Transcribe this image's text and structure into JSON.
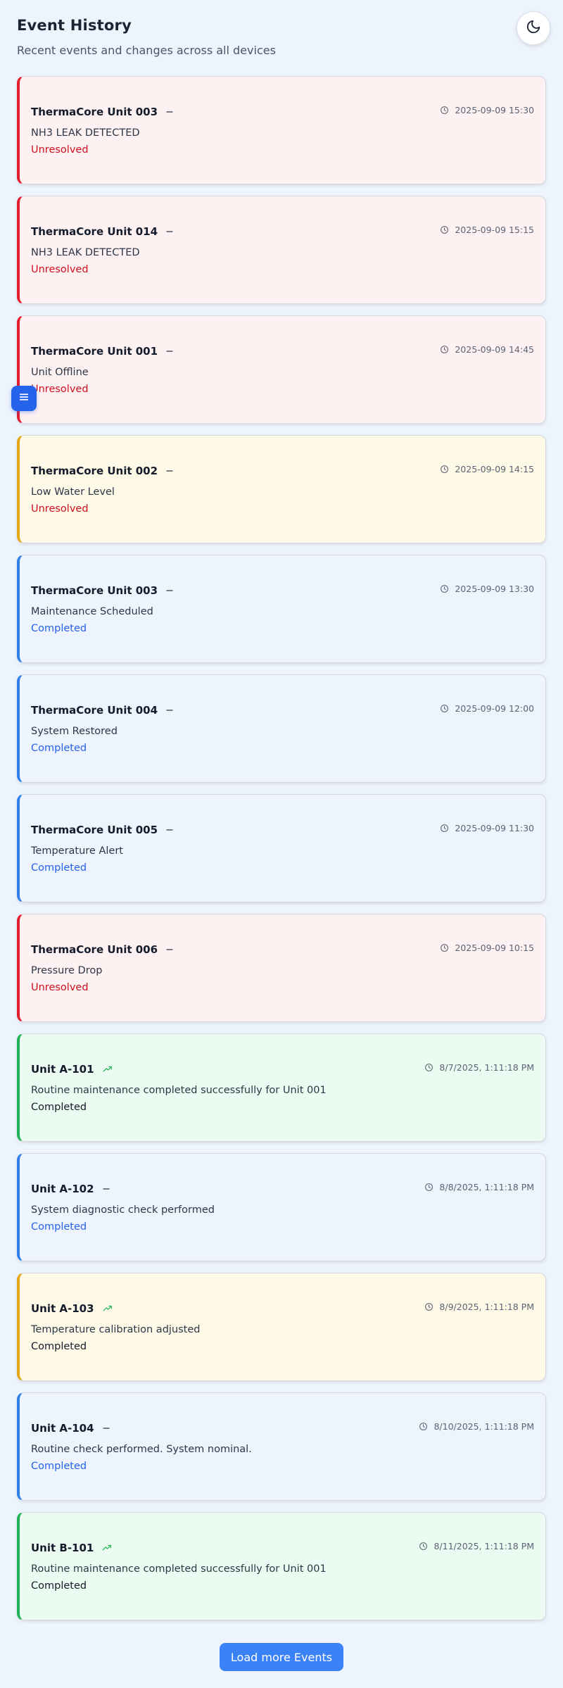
{
  "header": {
    "title": "Event History",
    "subtitle": "Recent events and changes across all devices"
  },
  "theme_toggle": {
    "icon": "moon-icon"
  },
  "menu_button": {
    "icon": "menu-icon"
  },
  "colors": {
    "critical": "#e11d2f",
    "warning": "#e5a81a",
    "info": "#2f7fe8",
    "success": "#20b256",
    "accent": "#3b82f6"
  },
  "events": [
    {
      "unit": "ThermaCore Unit 003",
      "trend": "minus-icon",
      "timestamp": "2025-09-09 15:30",
      "description": "NH3 LEAK DETECTED",
      "status": "Unresolved",
      "severity": "red",
      "status_color": "red"
    },
    {
      "unit": "ThermaCore Unit 014",
      "trend": "minus-icon",
      "timestamp": "2025-09-09 15:15",
      "description": "NH3 LEAK DETECTED",
      "status": "Unresolved",
      "severity": "red",
      "status_color": "red"
    },
    {
      "unit": "ThermaCore Unit 001",
      "trend": "minus-icon",
      "timestamp": "2025-09-09 14:45",
      "description": "Unit Offline",
      "status": "Unresolved",
      "severity": "red",
      "status_color": "red"
    },
    {
      "unit": "ThermaCore Unit 002",
      "trend": "minus-icon",
      "timestamp": "2025-09-09 14:15",
      "description": "Low Water Level",
      "status": "Unresolved",
      "severity": "yellow",
      "status_color": "red"
    },
    {
      "unit": "ThermaCore Unit 003",
      "trend": "minus-icon",
      "timestamp": "2025-09-09 13:30",
      "description": "Maintenance Scheduled",
      "status": "Completed",
      "severity": "blue",
      "status_color": "blue"
    },
    {
      "unit": "ThermaCore Unit 004",
      "trend": "minus-icon",
      "timestamp": "2025-09-09 12:00",
      "description": "System Restored",
      "status": "Completed",
      "severity": "blue",
      "status_color": "blue"
    },
    {
      "unit": "ThermaCore Unit 005",
      "trend": "minus-icon",
      "timestamp": "2025-09-09 11:30",
      "description": "Temperature Alert",
      "status": "Completed",
      "severity": "blue",
      "status_color": "blue"
    },
    {
      "unit": "ThermaCore Unit 006",
      "trend": "minus-icon",
      "timestamp": "2025-09-09 10:15",
      "description": "Pressure Drop",
      "status": "Unresolved",
      "severity": "red",
      "status_color": "red"
    },
    {
      "unit": "Unit A-101",
      "trend": "trending-up-icon",
      "timestamp": "8/7/2025, 1:11:18 PM",
      "description": "Routine maintenance completed successfully for Unit 001",
      "status": "Completed",
      "severity": "green",
      "status_color": "dark"
    },
    {
      "unit": "Unit A-102",
      "trend": "minus-icon",
      "timestamp": "8/8/2025, 1:11:18 PM",
      "description": "System diagnostic check performed",
      "status": "Completed",
      "severity": "blue",
      "status_color": "blue"
    },
    {
      "unit": "Unit A-103",
      "trend": "trending-up-icon",
      "timestamp": "8/9/2025, 1:11:18 PM",
      "description": "Temperature calibration adjusted",
      "status": "Completed",
      "severity": "yellow",
      "status_color": "dark"
    },
    {
      "unit": "Unit A-104",
      "trend": "minus-icon",
      "timestamp": "8/10/2025, 1:11:18 PM",
      "description": "Routine check performed. System nominal.",
      "status": "Completed",
      "severity": "blue",
      "status_color": "blue"
    },
    {
      "unit": "Unit B-101",
      "trend": "trending-up-icon",
      "timestamp": "8/11/2025, 1:11:18 PM",
      "description": "Routine maintenance completed successfully for Unit 001",
      "status": "Completed",
      "severity": "green",
      "status_color": "dark"
    }
  ],
  "load_more": {
    "label": "Load more Events"
  }
}
